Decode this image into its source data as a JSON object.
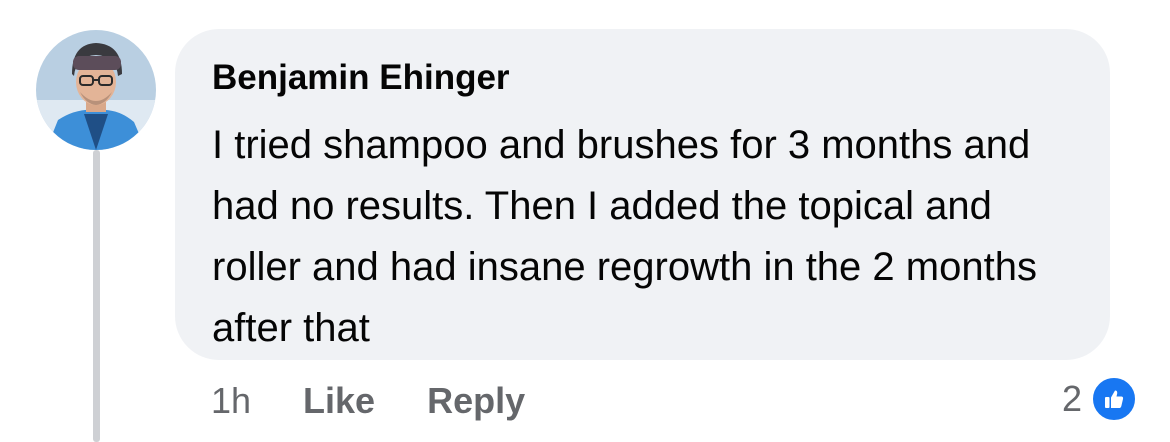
{
  "comment": {
    "author": "Benjamin Ehinger",
    "text": "I tried shampoo and brushes for 3 months and had no results. Then I added the topical and roller and had insane regrowth in the 2 months after that",
    "timestamp": "1h",
    "like_label": "Like",
    "reply_label": "Reply",
    "reaction_count": "2",
    "reaction_icon": "thumbs-up-icon"
  },
  "colors": {
    "bubble_background": "#f0f2f5",
    "secondary_text": "#65676b",
    "like_blue": "#1877f2"
  }
}
